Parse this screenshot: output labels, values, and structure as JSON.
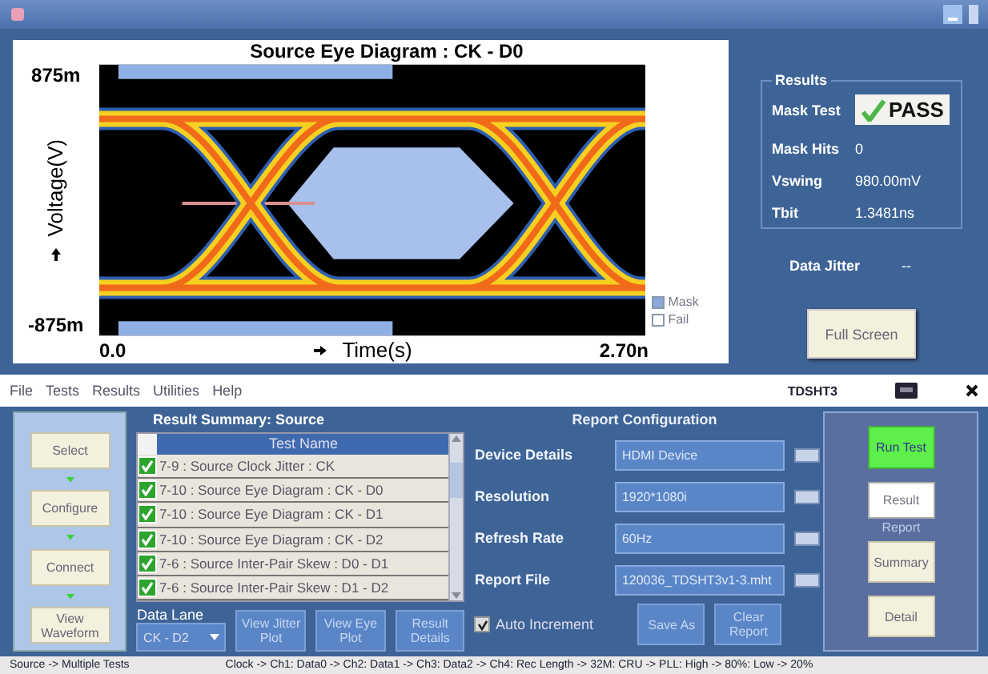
{
  "plot": {
    "title": "Source Eye Diagram : CK - D0",
    "y_max": "875m",
    "y_axis_label": "Voltage(V)",
    "y_min": "-875m",
    "x_min": "0.0",
    "x_axis_label": "Time(s)",
    "x_max": "2.70n",
    "legend": [
      {
        "label": "Mask",
        "checked": true
      },
      {
        "label": "Fail",
        "checked": false
      }
    ]
  },
  "results": {
    "title": "Results",
    "rows": [
      {
        "label": "Mask Test",
        "value": "PASS",
        "kind": "badge"
      },
      {
        "label": "Mask Hits",
        "value": "0",
        "kind": "text"
      },
      {
        "label": "Vswing",
        "value": "980.00mV",
        "kind": "text"
      },
      {
        "label": "Tbit",
        "value": "1.3481ns",
        "kind": "text"
      }
    ],
    "data_jitter": {
      "label": "Data Jitter",
      "value": "--"
    },
    "full_screen_button": "Full Screen"
  },
  "menu": [
    "File",
    "Tests",
    "Results",
    "Utilities",
    "Help"
  ],
  "app_name": "TDSHT3",
  "workflow_buttons": [
    "Select",
    "Configure",
    "Connect",
    "View Waveform"
  ],
  "result_summary": {
    "title": "Result Summary: Source",
    "column": "Test Name",
    "rows": [
      {
        "name": "7-9 : Source Clock Jitter : CK",
        "checked": true
      },
      {
        "name": "7-10 : Source Eye Diagram : CK - D0",
        "checked": true
      },
      {
        "name": "7-10 : Source Eye Diagram : CK - D1",
        "checked": true
      },
      {
        "name": "7-10 : Source Eye Diagram : CK - D2",
        "checked": true
      },
      {
        "name": "7-6 : Source Inter-Pair Skew : D0 - D1",
        "checked": true
      },
      {
        "name": "7-6 : Source Inter-Pair Skew : D1 - D2",
        "checked": true
      }
    ]
  },
  "data_lane": {
    "label": "Data Lane",
    "value": "CK - D2"
  },
  "plot_buttons": [
    "View Jitter Plot",
    "View Eye Plot",
    "Result Details"
  ],
  "report_configuration": {
    "title": "Report Configuration",
    "fields": [
      {
        "label": "Device Details",
        "value": "HDMI Device"
      },
      {
        "label": "Resolution",
        "value": "1920*1080i"
      },
      {
        "label": "Refresh Rate",
        "value": "60Hz"
      },
      {
        "label": "Report File",
        "value": "120036_TDSHT3v1-3.mht"
      }
    ],
    "auto_increment": {
      "label": "Auto Increment",
      "checked": true
    },
    "buttons": [
      "Save As",
      "Clear Report"
    ]
  },
  "run_panel": {
    "run_button": "Run Test",
    "result_button": "Result",
    "report_label": "Report",
    "report_buttons": [
      "Summary",
      "Detail"
    ]
  },
  "status_bar": {
    "left": "Source -> Multiple Tests",
    "right": "Clock -> Ch1: Data0 -> Ch2: Data1 -> Ch3: Data2 -> Ch4: Rec Length -> 32M: CRU -> PLL: High -> 80%: Low -> 20%"
  }
}
